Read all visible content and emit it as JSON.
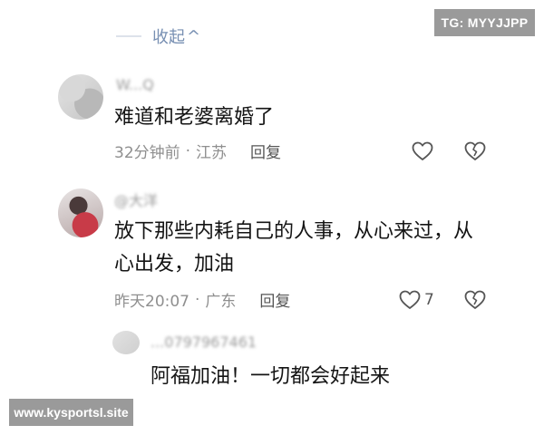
{
  "watermarks": {
    "top_right": "TG: MYYJJPP",
    "bottom_left": "www.kysportsl.site"
  },
  "thread": {
    "collapse_label": "收起",
    "collapse_icon": "chevron-up-icon"
  },
  "comments": [
    {
      "username": "W...Q",
      "text": "难道和老婆离婚了",
      "time": "32分钟前",
      "location": "江苏",
      "reply_label": "回复",
      "like_icon": "heart-outline-icon",
      "dislike_icon": "broken-heart-icon"
    },
    {
      "username": "@大洋",
      "text": "放下那些内耗自己的人事，从心来过，从心出发，加油",
      "time": "昨天20:07",
      "location": "广东",
      "reply_label": "回复",
      "like_count": "7",
      "like_icon": "heart-outline-icon",
      "dislike_icon": "broken-heart-icon"
    }
  ],
  "reply": {
    "username": "...0797967461",
    "text": "阿福加油！一切都会好起来"
  }
}
